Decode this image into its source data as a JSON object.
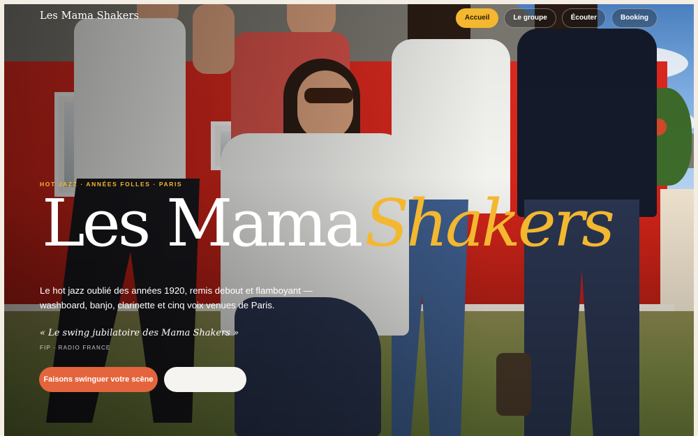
{
  "header": {
    "brand": "Les Mama Shakers",
    "nav": [
      {
        "label": "Accueil",
        "active": true
      },
      {
        "label": "Le groupe",
        "active": false
      },
      {
        "label": "Écouter",
        "active": false
      },
      {
        "label": "Booking",
        "active": false
      }
    ]
  },
  "hero": {
    "eyebrow": "HOT JAZZ · ANNÉES FOLLES · PARIS",
    "title_main": "Les Mama",
    "title_accent": "Shakers",
    "lede": "Le hot jazz oublié des années 1920, remis debout et flamboyant — washboard, banjo, clarinette et cinq voix venues de Paris.",
    "quote": "« Le swing jubilatoire des Mama Shakers »",
    "quote_source": "FIP · RADIO FRANCE",
    "cta_primary": "Faisons swinguer votre scène",
    "cta_secondary": ""
  },
  "colors": {
    "accent": "#f3b730",
    "cta": "#e4653d"
  }
}
